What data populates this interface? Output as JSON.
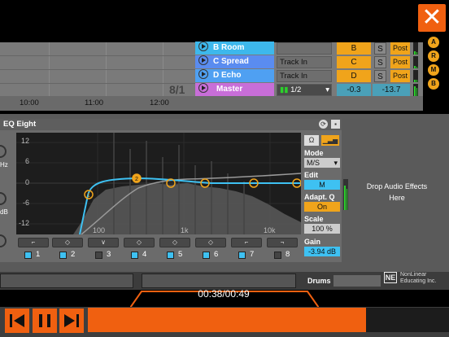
{
  "session": {
    "tracks": [
      {
        "name": "B Room",
        "color": "#3db8ec",
        "routing": "",
        "send": "B",
        "solo": "S",
        "post": "Post"
      },
      {
        "name": "C Spread",
        "color": "#5a8cf0",
        "routing": "Track In",
        "send": "C",
        "solo": "S",
        "post": "Post"
      },
      {
        "name": "D Echo",
        "color": "#4fa0f2",
        "routing": "Track In",
        "send": "D",
        "solo": "S",
        "post": "Post"
      },
      {
        "name": "Master",
        "color": "#c86ed8",
        "routing": "1/2",
        "send": "-0.3",
        "send2": "-13.7"
      }
    ],
    "scene_marker": "8/1",
    "side_buttons": [
      "A",
      "R",
      "M",
      "B"
    ]
  },
  "ruler": {
    "ticks": [
      "10:00",
      "11:00",
      "12:00"
    ]
  },
  "eq": {
    "title": "EQ Eight",
    "db_labels": [
      "12",
      "6",
      "0",
      "-6",
      "-12"
    ],
    "freq_labels": [
      "100",
      "1k",
      "10k"
    ],
    "bands": [
      {
        "num": "1",
        "active": true
      },
      {
        "num": "2",
        "active": true
      },
      {
        "num": "3",
        "active": false
      },
      {
        "num": "4",
        "active": true
      },
      {
        "num": "5",
        "active": true
      },
      {
        "num": "6",
        "active": true
      },
      {
        "num": "7",
        "active": true
      },
      {
        "num": "8",
        "active": false
      }
    ],
    "params": {
      "mode_label": "Mode",
      "mode_value": "M/S",
      "edit_label": "Edit",
      "edit_value": "M",
      "adapt_label": "Adapt. Q",
      "adapt_value": "On",
      "scale_label": "Scale",
      "scale_value": "100 %",
      "gain_label": "Gain",
      "gain_value": "-3.94 dB"
    },
    "left_clip_labels": [
      "Hz",
      "dB"
    ]
  },
  "drop_zone": {
    "text_line1": "Drop Audio Effects",
    "text_line2": "Here"
  },
  "bottom": {
    "drums_label": "Drums",
    "brand_logo": "NE",
    "brand_line1": "NonLinear",
    "brand_line2": "Educating Inc."
  },
  "player": {
    "time": "00:38/00:49",
    "progress_fraction": 0.77,
    "accent": "#f06010"
  },
  "icons": {
    "close": "close-icon",
    "prev": "skip-back-icon",
    "pause": "pause-icon",
    "next": "skip-forward-icon"
  }
}
